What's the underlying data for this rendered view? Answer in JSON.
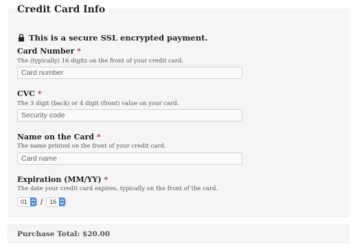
{
  "header": {
    "title": "Credit Card Info"
  },
  "secure_notice": {
    "icon": "lock-icon",
    "text": "This is a secure SSL encrypted payment."
  },
  "fields": {
    "card_number": {
      "label": "Card Number",
      "required_mark": "*",
      "description": "The (typically) 16 digits on the front of your credit card.",
      "placeholder": "Card number",
      "value": ""
    },
    "cvc": {
      "label": "CVC",
      "required_mark": "*",
      "description": "The 3 digit (back) or 4 digit (front) value on your card.",
      "placeholder": "Security code",
      "value": ""
    },
    "name": {
      "label": "Name on the Card",
      "required_mark": "*",
      "description": "The name printed on the front of your credit card.",
      "placeholder": "Card name",
      "value": ""
    },
    "expiration": {
      "label": "Expiration (MM/YY)",
      "required_mark": "*",
      "description": "The date your credit card expires, typically on the front of the card.",
      "month": "01",
      "separator": "/",
      "year": "16"
    }
  },
  "purchase": {
    "label": "Purchase Total:",
    "amount": "$20.00"
  },
  "colors": {
    "panel": "#f5f5f5",
    "required": "#c0392b",
    "select_accent": "#3d86e6"
  }
}
